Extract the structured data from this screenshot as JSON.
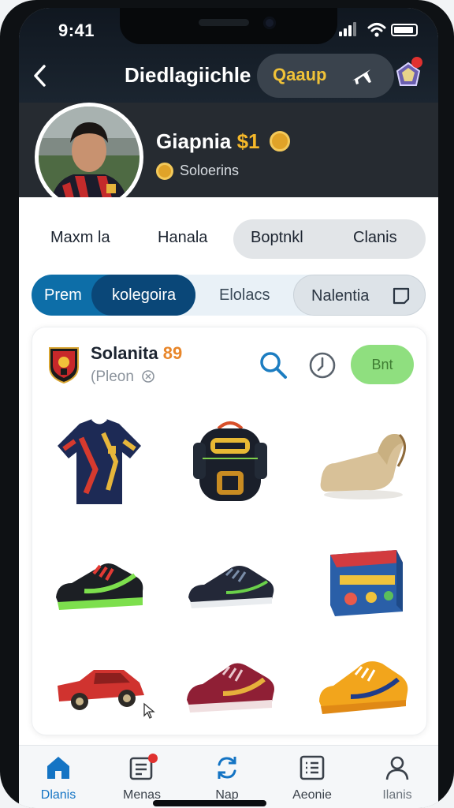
{
  "status_bar": {
    "time": "9:41"
  },
  "nav": {
    "title": "Diedlagiichle",
    "pill_label": "Qaaup",
    "back_icon": "chevron-left-icon",
    "pill_icon": "plane-icon"
  },
  "profile": {
    "name": "Giapnia",
    "amount": "$1",
    "subtitle": "Soloerins"
  },
  "tabs_row1": {
    "tab_a": "Maxm la",
    "tab_b": "Hanala",
    "tab_c": "Boptnkl",
    "tab_d": "Clanis"
  },
  "tabs_row2": {
    "tab_a": "Prem",
    "tab_b": "kolegoira",
    "tab_c": "Elolacs",
    "tab_d": "Nalentia"
  },
  "card": {
    "title": "Solanita",
    "number": "89",
    "subtitle": "(Pleon",
    "button": "Bnt"
  },
  "products": [
    {
      "name": "jersey"
    },
    {
      "name": "backpack"
    },
    {
      "name": "boot"
    },
    {
      "name": "sneaker-black-green"
    },
    {
      "name": "sneaker-dark-blue"
    },
    {
      "name": "game-box"
    },
    {
      "name": "toy-car"
    },
    {
      "name": "sneaker-maroon"
    },
    {
      "name": "sneaker-yellow"
    }
  ],
  "bottom_nav": {
    "item_1": "Dlanis",
    "item_2": "Menas",
    "item_3": "Nap",
    "item_4": "Aeonie",
    "item_5": "Ilanis"
  },
  "colors": {
    "accent_blue": "#0d6ea8",
    "accent_green": "#8fdf7f",
    "accent_gold": "#f5b82a"
  }
}
